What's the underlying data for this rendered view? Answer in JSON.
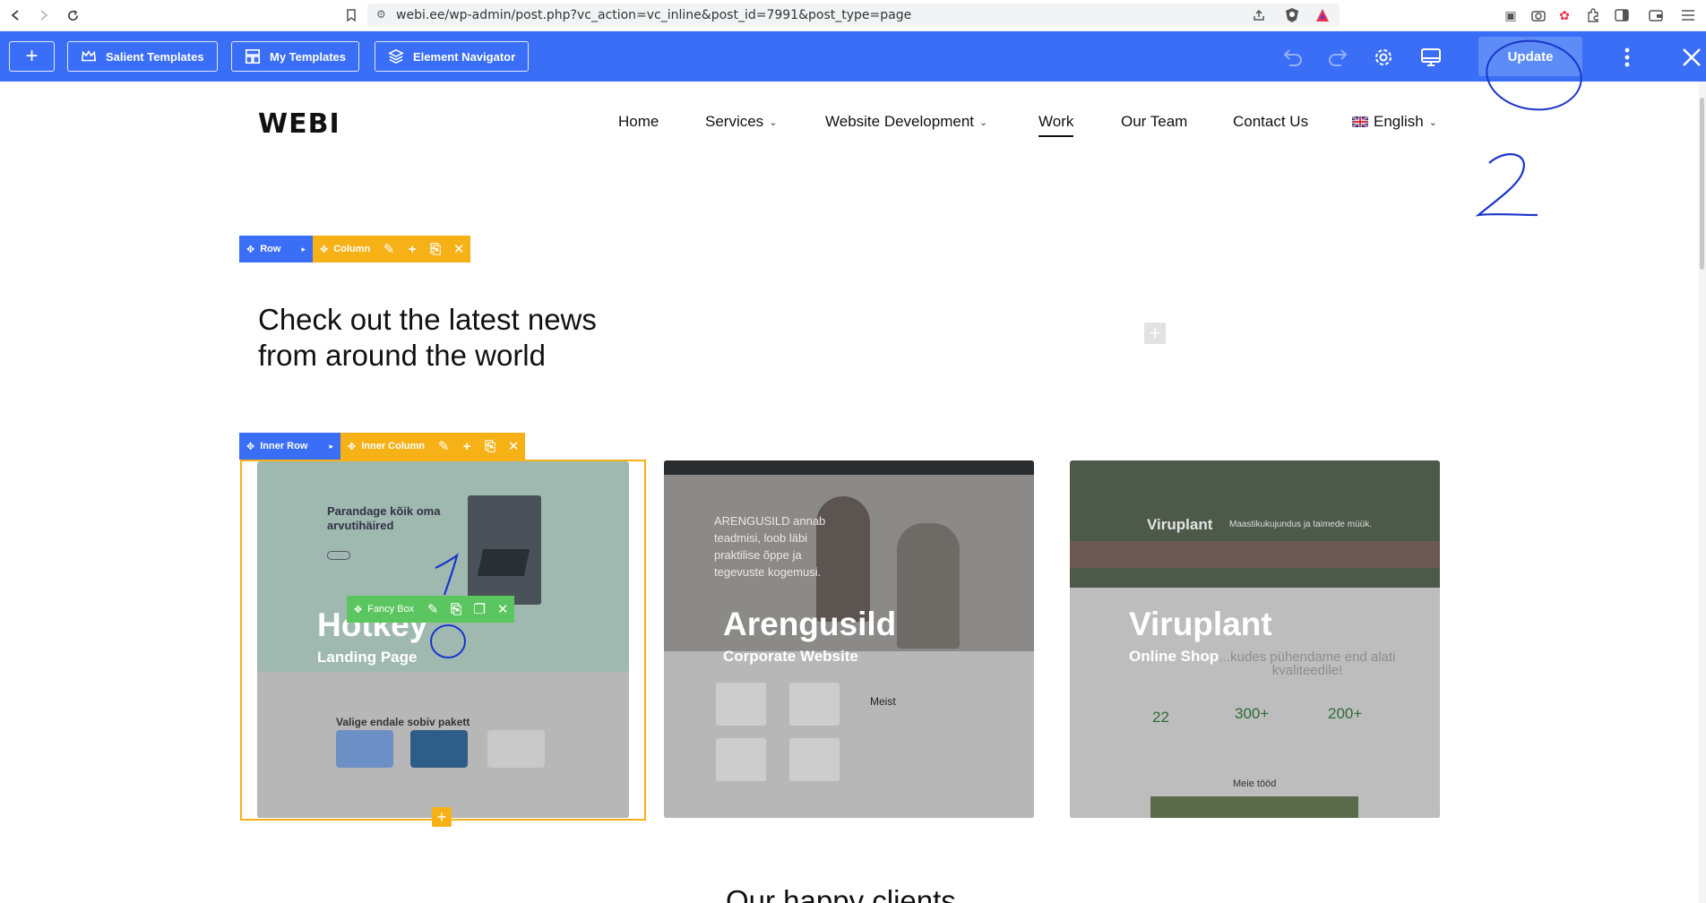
{
  "browser": {
    "url": "webi.ee/wp-admin/post.php?vc_action=vc_inline&post_id=7991&post_type=page"
  },
  "builder_toolbar": {
    "salient_templates": "Salient Templates",
    "my_templates": "My Templates",
    "element_navigator": "Element Navigator",
    "update": "Update"
  },
  "site": {
    "logo": "WEBI",
    "menu": [
      "Home",
      "Services",
      "Website Development",
      "Work",
      "Our Team",
      "Contact Us",
      "English"
    ],
    "active_menu": "Work"
  },
  "controls": {
    "row": "Row",
    "column": "Column",
    "inner_row": "Inner Row",
    "inner_column": "Inner Column",
    "fancy_box": "Fancy Box"
  },
  "content": {
    "headline_line1": "Check out the latest news",
    "headline_line2": "from around the world",
    "bottom_heading": "Our happy clients"
  },
  "cards": [
    {
      "title": "Hotkey",
      "subtitle": "Landing Page",
      "preview_heading": "Parandage kõik oma arvutihäired",
      "preview_section": "Valige endale sobiv pakett"
    },
    {
      "title": "Arengusild",
      "subtitle": "Corporate Website",
      "preview_text": "ARENGUSILD annab teadmisi, loob läbi praktilise õppe ja tegevuste kogemusi.",
      "preview_section": "Meist"
    },
    {
      "title": "Viruplant",
      "subtitle": "Online Shop",
      "preview_brand": "Viruplant",
      "preview_tag": "Maastikukujundus ja taimede müük.",
      "preview_text": "...kudes pühendame end alati kvaliteedile!",
      "stats": [
        "22",
        "300+",
        "200+"
      ],
      "preview_section": "Meie tööd"
    }
  ],
  "annotations": {
    "step1": "1",
    "step2": "2"
  },
  "colors": {
    "builder_blue": "#3a6ef6",
    "control_orange": "#f6b117",
    "control_green": "#5bc65f",
    "annotation_ink": "#1a36c9"
  }
}
